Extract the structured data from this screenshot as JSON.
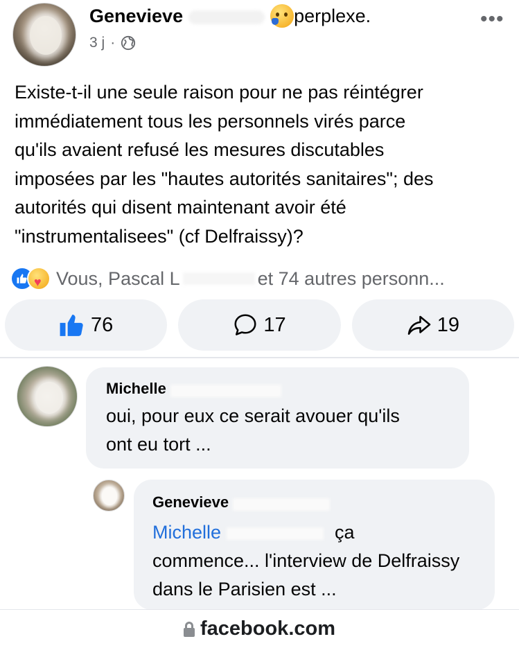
{
  "post": {
    "author": "Genevieve",
    "feeling": "perplexe.",
    "time": "3 j",
    "separator": "·",
    "privacy_icon": "globe-icon",
    "more_label": "•••",
    "text": "Existe-t-il une seule raison pour ne pas réintégrer\nimmédiatement tous les personnels virés parce\nqu'ils avaient refusé les mesures discutables\nimposées par les \"hautes autorités sanitaires\"; des\nautorités qui  disent maintenant avoir été\n\"instrumentalisees\" (cf  Delfraissy)?"
  },
  "reactions": {
    "icons": [
      "like-icon",
      "care-icon"
    ],
    "prefix": "Vous, Pascal L",
    "suffix": "et 74 autres personn..."
  },
  "actions": {
    "likes": "76",
    "comments": "17",
    "shares": "19"
  },
  "comments": [
    {
      "author": "Michelle",
      "text": "oui, pour eux ce serait avouer qu'ils\nont eu tort ..."
    },
    {
      "author": "Genevieve",
      "mention": "Michelle",
      "text_after_mention": "ça",
      "text_rest": "commence... l'interview de Delfraissy dans le Parisien est  ..."
    }
  ],
  "browser": {
    "domain": "facebook.com"
  },
  "colors": {
    "brand_blue": "#1877f2",
    "mention_blue": "#216fdb",
    "bubble_gray": "#f0f2f5",
    "meta_gray": "#65676b"
  }
}
